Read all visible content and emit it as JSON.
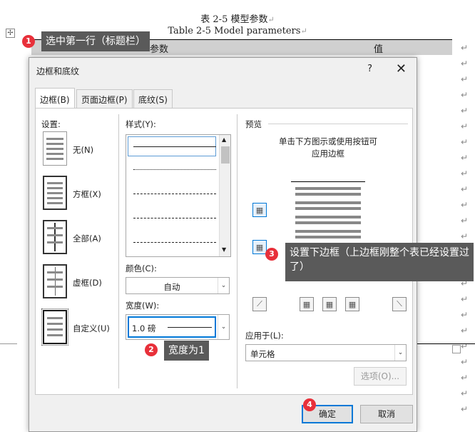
{
  "document": {
    "caption_cn": "表 2-5 模型参数",
    "caption_en": "Table 2-5 Model parameters",
    "header_param": "参数",
    "header_value": "值"
  },
  "dialog": {
    "title": "边框和底纹",
    "help": "?",
    "close": "✕",
    "tabs": [
      "边框(B)",
      "页面边框(P)",
      "底纹(S)"
    ],
    "settings_label": "设置:",
    "settings": [
      "无(N)",
      "方框(X)",
      "全部(A)",
      "虚框(D)",
      "自定义(U)"
    ],
    "style_label": "样式(Y):",
    "color_label": "颜色(C):",
    "color_value": "自动",
    "width_label": "宽度(W):",
    "width_value": "1.0 磅",
    "preview_label": "预览",
    "preview_hint": "单击下方图示或使用按钮可应用边框",
    "apply_label": "应用于(L):",
    "apply_value": "单元格",
    "options_button": "选项(O)...",
    "ok_button": "确定",
    "cancel_button": "取消"
  },
  "annotations": [
    {
      "number": "1",
      "text": "选中第一行（标题栏）"
    },
    {
      "number": "2",
      "text": "宽度为1"
    },
    {
      "number": "3",
      "text": "设置下边框（上边框刚整个表已经设置过了）"
    },
    {
      "number": "4",
      "text": ""
    }
  ],
  "colors": {
    "accent": "#0078d7",
    "badge": "#e8303a",
    "callout": "#5a5a5a"
  }
}
